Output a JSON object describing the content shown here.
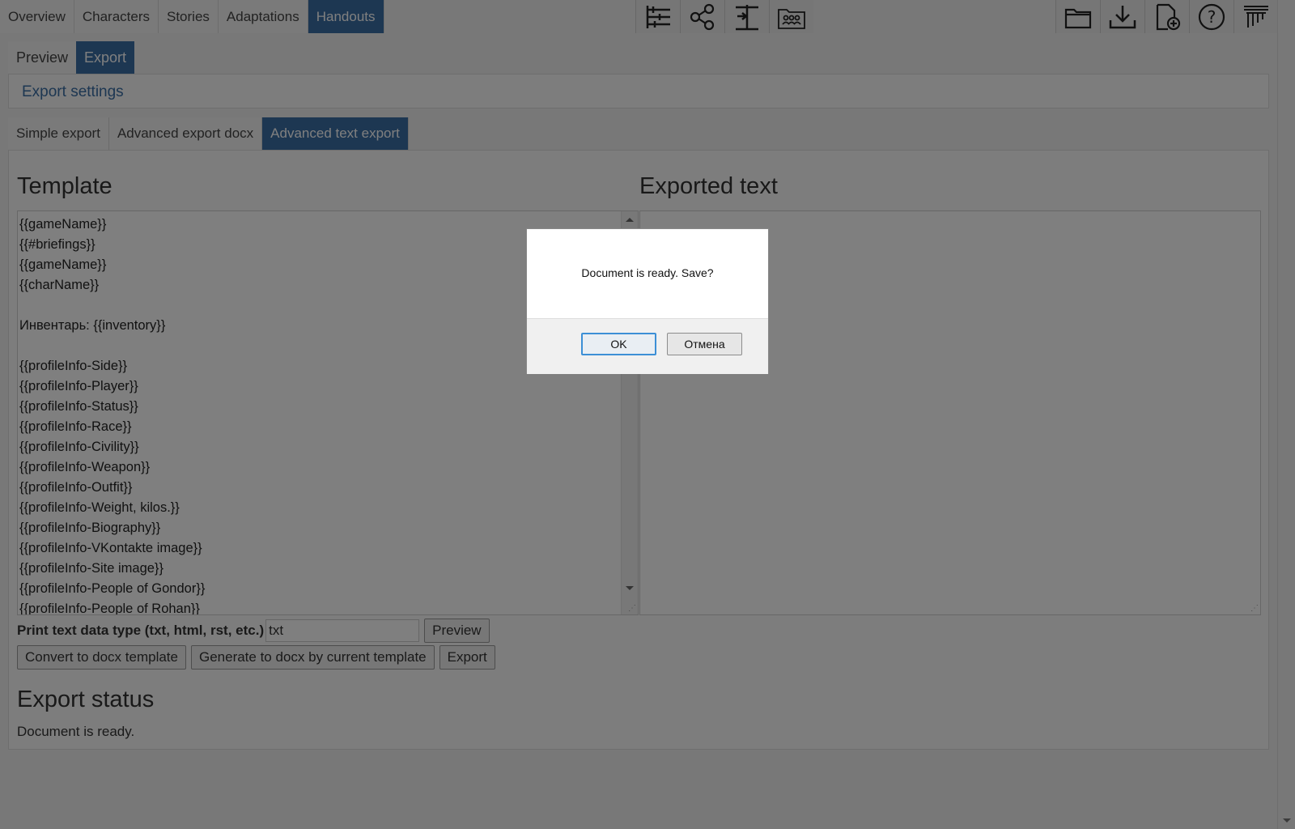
{
  "nav": {
    "tabs": [
      {
        "label": "Overview"
      },
      {
        "label": "Characters"
      },
      {
        "label": "Stories"
      },
      {
        "label": "Adaptations"
      },
      {
        "label": "Handouts"
      }
    ],
    "active": "Handouts",
    "mid_icons": [
      "sliders-icon",
      "share-icon",
      "signpost-icon",
      "groups-icon"
    ],
    "right_icons": [
      "folder-icon",
      "download-icon",
      "new-file-icon",
      "help-icon",
      "logout-icon"
    ]
  },
  "subtabs": {
    "preview": "Preview",
    "export": "Export"
  },
  "settings": {
    "title": "Export settings"
  },
  "export_tabs": {
    "simple": "Simple export",
    "docx": "Advanced export docx",
    "text": "Advanced text export"
  },
  "template": {
    "heading": "Template",
    "lines": "{{gameName}}\n{{#briefings}}\n{{gameName}}\n{{charName}}\n\nИнвентарь: {{inventory}}\n\n{{profileInfo-Side}}\n{{profileInfo-Player}}\n{{profileInfo-Status}}\n{{profileInfo-Race}}\n{{profileInfo-Civility}}\n{{profileInfo-Weapon}}\n{{profileInfo-Outfit}}\n{{profileInfo-Weight, kilos.}}\n{{profileInfo-Biography}}\n{{profileInfo-VKontakte image}}\n{{profileInfo-Site image}}\n{{profileInfo-People of Gondor}}\n{{profileInfo-People of Rohan}}"
  },
  "exported": {
    "heading": "Exported text",
    "content": ""
  },
  "print_type": {
    "label": "Print text data type (txt, html, rst, etc.)",
    "value": "txt",
    "preview_button": "Preview"
  },
  "buttons": {
    "convert": "Convert to docx template",
    "generate": "Generate to docx by current template",
    "export": "Export"
  },
  "status": {
    "heading": "Export status",
    "text": "Document is ready."
  },
  "dialog": {
    "message": "Document is ready. Save?",
    "ok": "OK",
    "cancel": "Отмена"
  }
}
